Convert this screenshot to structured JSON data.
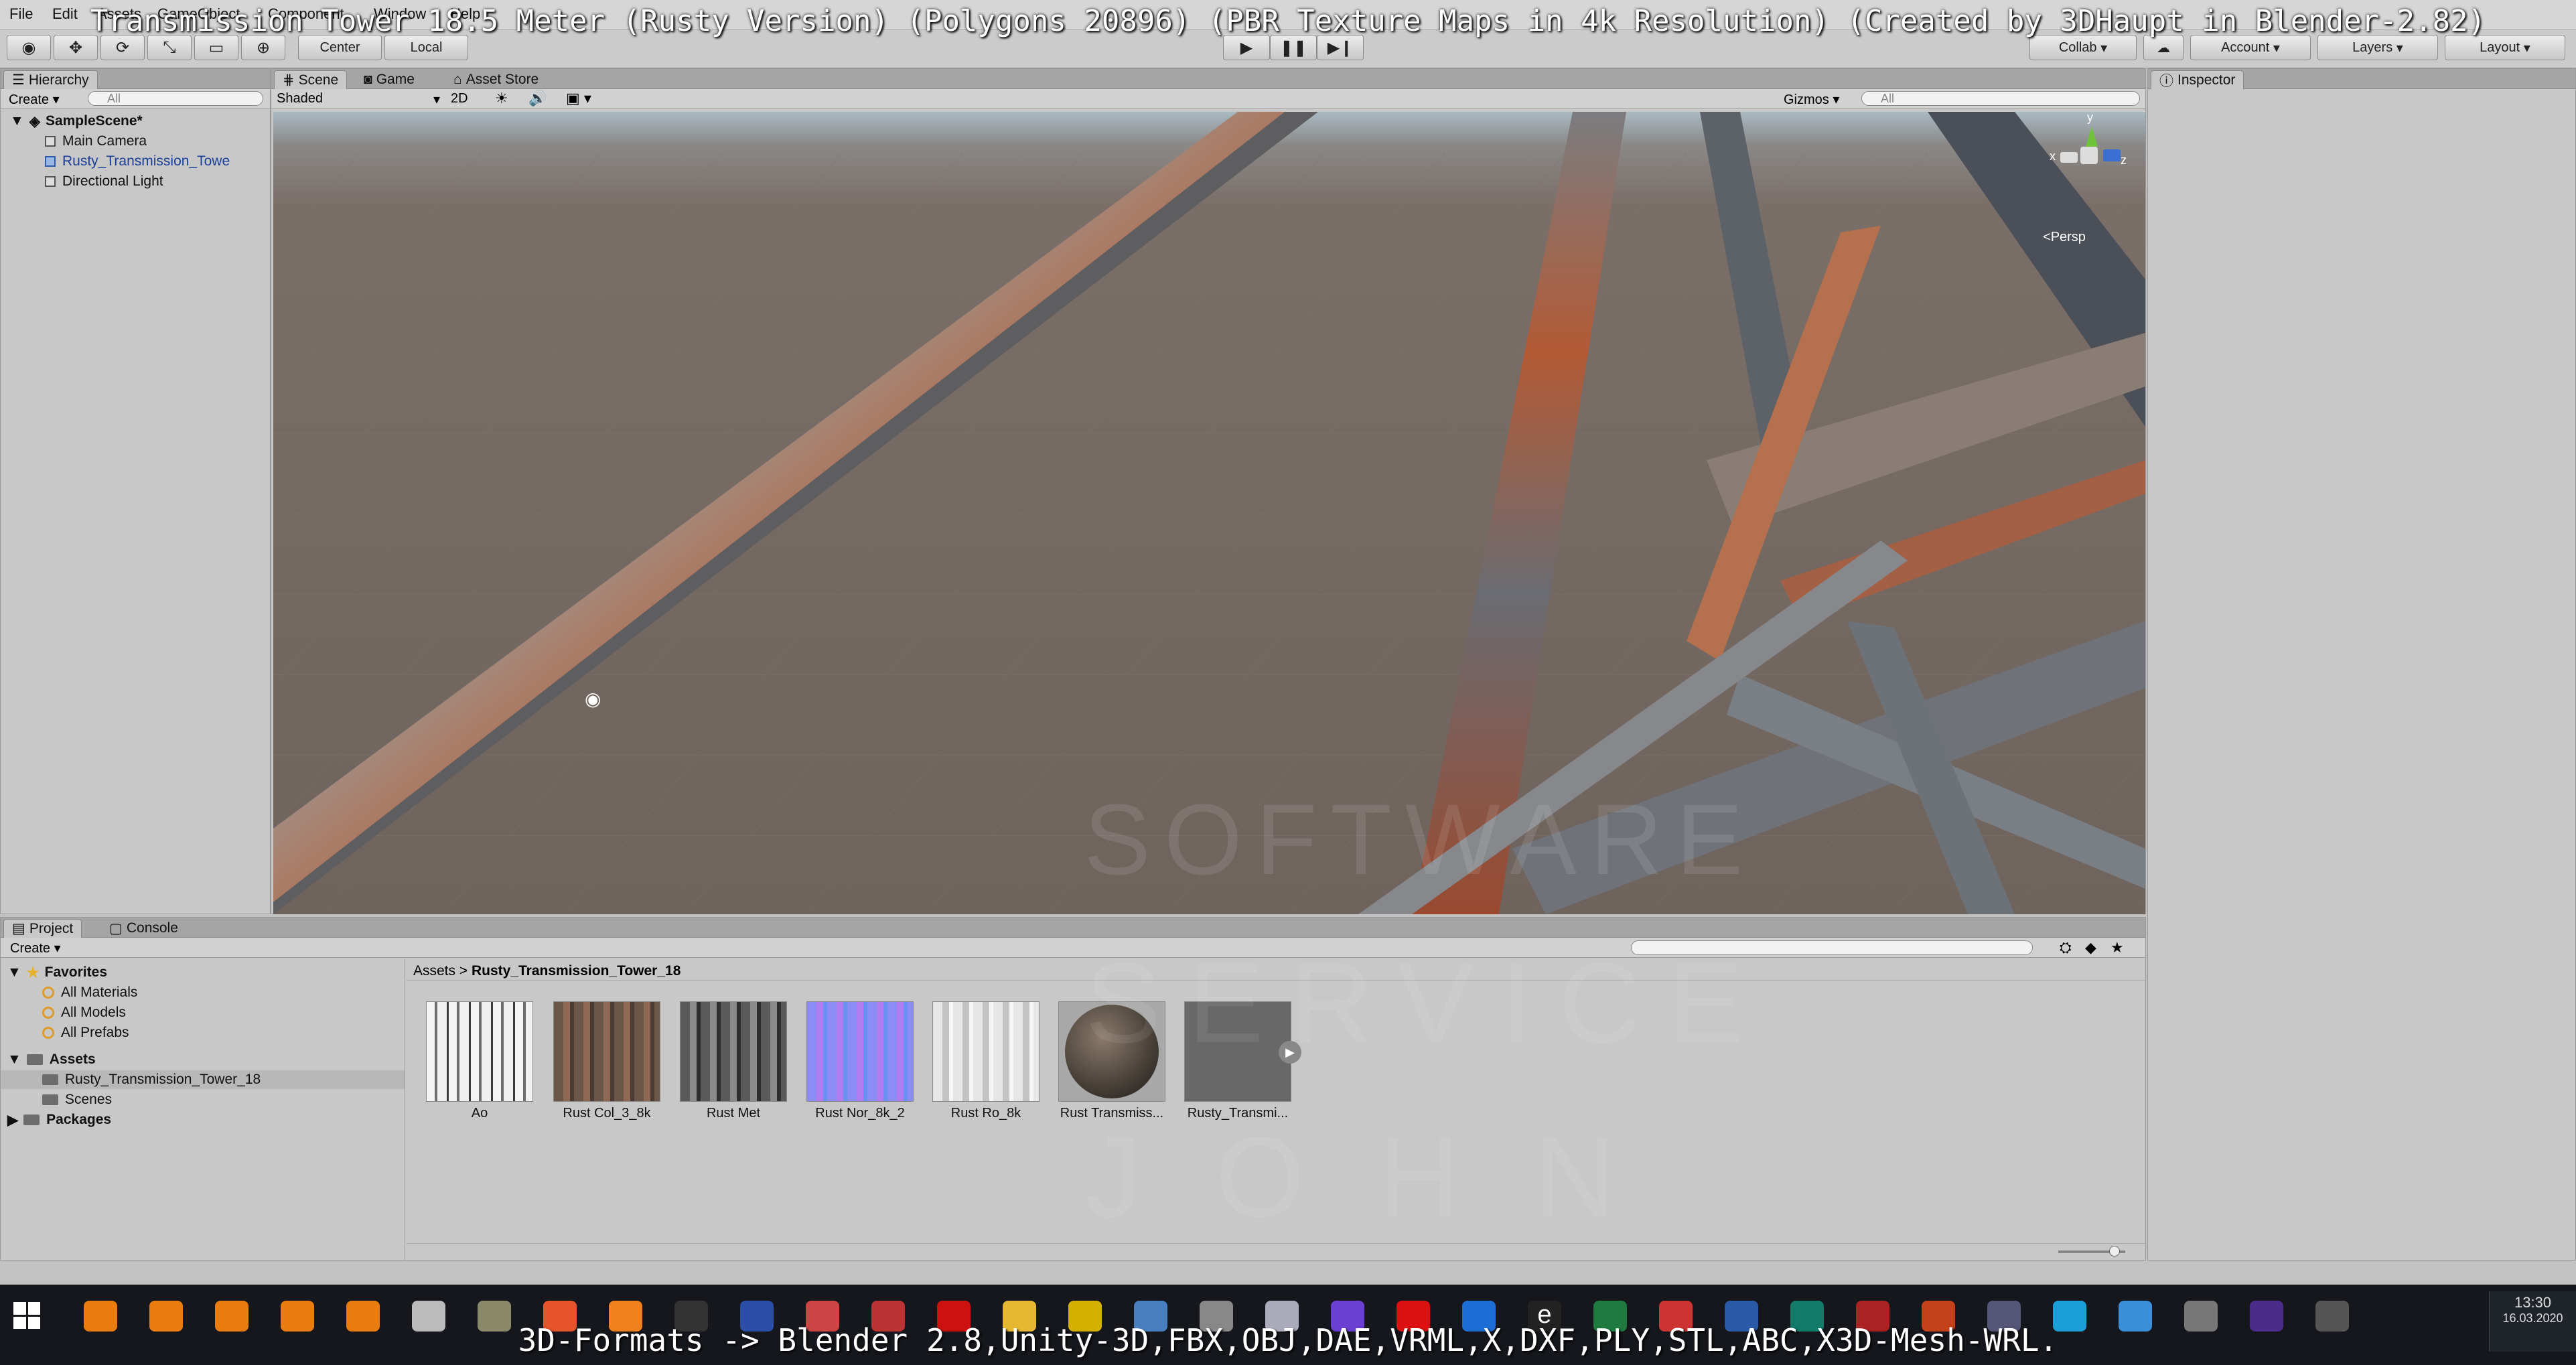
{
  "overlay_title": "Transmission Tower 18.5 Meter (Rusty Version) (Polygons 20896) (PBR Texture Maps in 4k Resolution) (Created by 3DHaupt in Blender-2.82)",
  "menu": [
    "File",
    "Edit",
    "Assets",
    "GameObject",
    "Component",
    "Window",
    "Help"
  ],
  "toolbar": {
    "pivot": "Center",
    "space": "Local",
    "collab": "Collab",
    "account": "Account",
    "layers": "Layers",
    "layout": "Layout"
  },
  "hierarchy": {
    "tab": "Hierarchy",
    "create": "Create",
    "search_placeholder": "All",
    "scene": "SampleScene*",
    "items": [
      "Main Camera",
      "Rusty_Transmission_Towe",
      "Directional Light"
    ]
  },
  "scene_view": {
    "tabs": [
      "Scene",
      "Game",
      "Asset Store"
    ],
    "shading": "Shaded",
    "mode_2d": "2D",
    "gizmos": "Gizmos",
    "search_placeholder": "All",
    "projection": "Persp",
    "gizmo_axes": {
      "y": "y",
      "x": "x",
      "z": "z"
    }
  },
  "inspector": {
    "tab": "Inspector"
  },
  "project": {
    "tabs": [
      "Project",
      "Console"
    ],
    "create": "Create",
    "breadcrumb_root": "Assets",
    "breadcrumb_current": "Rusty_Transmission_Tower_18",
    "favorites": {
      "label": "Favorites",
      "items": [
        "All Materials",
        "All Models",
        "All Prefabs"
      ]
    },
    "assets": {
      "label": "Assets",
      "items": [
        "Rusty_Transmission_Tower_18",
        "Scenes"
      ]
    },
    "packages": "Packages",
    "files": [
      {
        "label": "Ao"
      },
      {
        "label": "Rust Col_3_8k"
      },
      {
        "label": "Rust Met"
      },
      {
        "label": "Rust Nor_8k_2"
      },
      {
        "label": "Rust Ro_8k"
      },
      {
        "label": "Rust Transmiss..."
      },
      {
        "label": "Rusty_Transmi..."
      }
    ]
  },
  "watermark": [
    "SOFTWARE",
    "SERVICE",
    "JOHN"
  ],
  "taskbar": {
    "time": "13:30",
    "date": "16.03.2020"
  },
  "bottom_overlay": "3D-Formats -> Blender 2.8,Unity-3D,FBX,OBJ,DAE,VRML,X,DXF,PLY,STL,ABC,X3D-Mesh-WRL."
}
